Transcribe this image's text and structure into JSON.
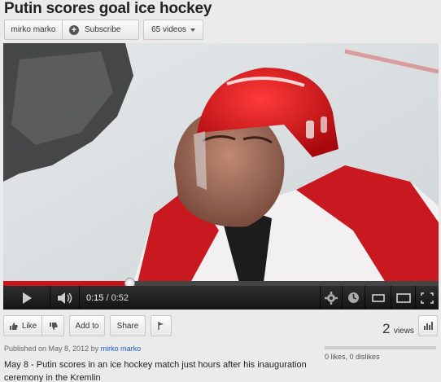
{
  "video": {
    "title": "Putin scores goal ice hockey"
  },
  "channel": {
    "name": "mirko marko",
    "subscribe_label": "Subscribe",
    "videos_label": "65 videos"
  },
  "player": {
    "current_time": "0:15",
    "separator": "/",
    "duration": "0:52",
    "progress_fraction": 0.29,
    "accent_color": "#c8141a"
  },
  "actions": {
    "like_label": "Like",
    "add_to_label": "Add to",
    "share_label": "Share"
  },
  "stats": {
    "views_count": "2",
    "views_label": "views",
    "likes_dislikes": "0 likes, 0 dislikes"
  },
  "info": {
    "published_prefix": "Published on May 8, 2012 by",
    "published_author": "mirko marko",
    "description": "May 8 - Putin scores in an ice hockey match just hours after his inauguration ceremony in the Kremlin"
  },
  "icons": [
    "plus-circle-icon",
    "chevron-down-icon",
    "play-icon",
    "volume-icon",
    "gear-icon",
    "clock-icon",
    "small-player-icon",
    "large-player-icon",
    "fullscreen-icon",
    "thumbs-up-icon",
    "thumbs-down-icon",
    "flag-icon",
    "stats-icon"
  ]
}
